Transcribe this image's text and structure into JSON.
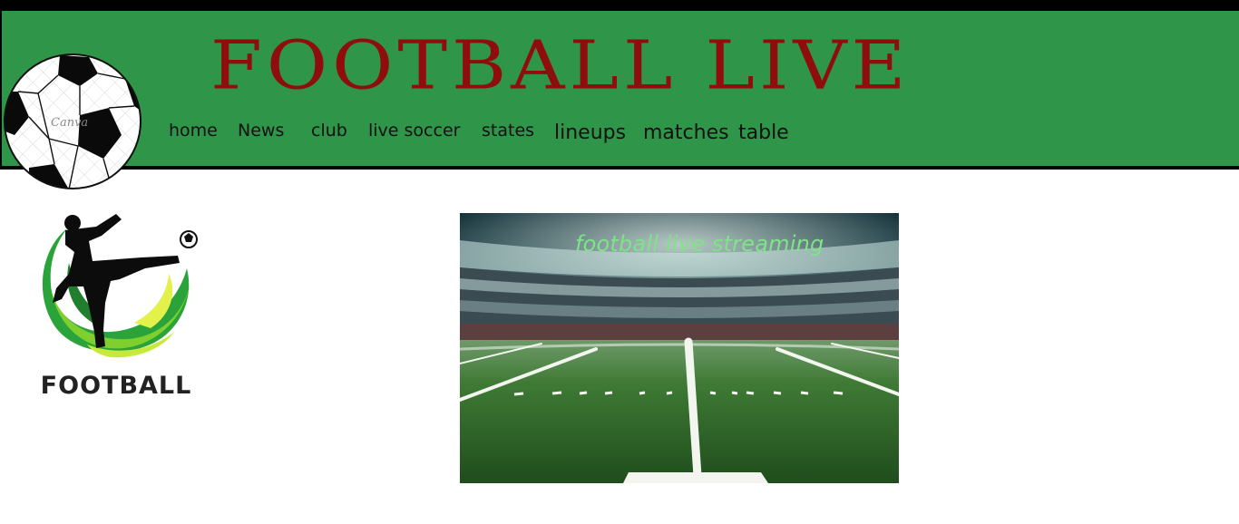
{
  "header": {
    "title": "FOOTBALL LIVE",
    "ball_watermark": "Canva",
    "nav": [
      "home",
      "News",
      "club",
      "live soccer",
      "states",
      "lineups",
      "matches",
      "table"
    ]
  },
  "sidebar": {
    "logo_text": "FOOTBALL"
  },
  "hero": {
    "caption": "football live streaming"
  },
  "colors": {
    "header_bg": "#2e9549",
    "title": "#8f0d0c",
    "caption": "#7ee487",
    "logo_green": "#6fbd2d"
  }
}
